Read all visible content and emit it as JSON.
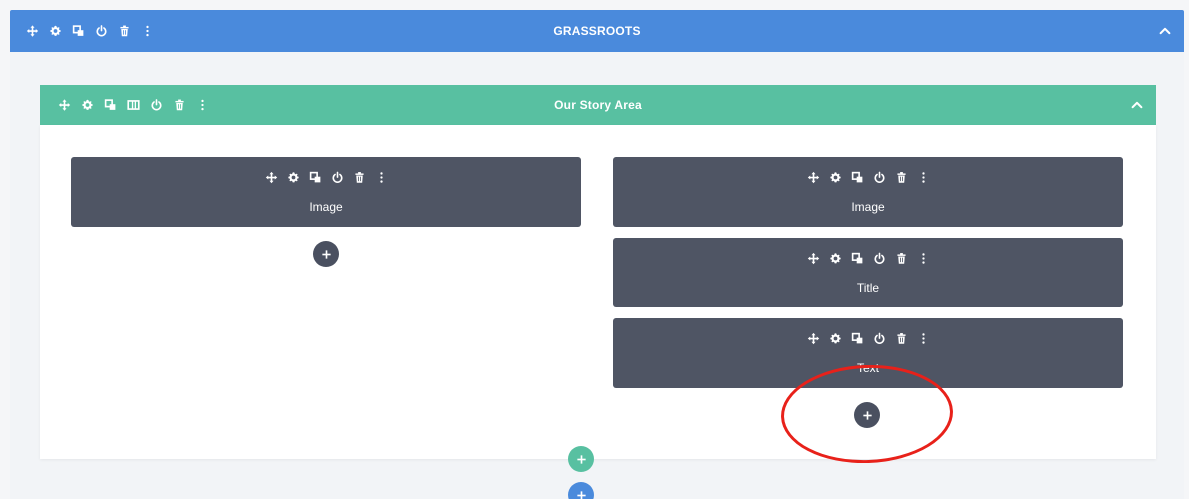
{
  "section": {
    "title": "GRASSROOTS",
    "color": "#4a8adc"
  },
  "row": {
    "title": "Our Story Area",
    "color": "#58c0a1"
  },
  "modules": {
    "left_image": {
      "label": "Image"
    },
    "right_image": {
      "label": "Image"
    },
    "right_title": {
      "label": "Title"
    },
    "right_text": {
      "label": "Text"
    }
  },
  "icons": {
    "move": "move-icon",
    "settings": "gear-icon",
    "duplicate": "duplicate-icon",
    "columns": "columns-icon",
    "toggle": "power-icon",
    "delete": "trash-icon",
    "more": "more-vertical-icon",
    "collapse": "chevron-up-icon",
    "add": "plus-icon"
  },
  "colors": {
    "module": "#4f5564",
    "annotation": "#e8211a"
  }
}
